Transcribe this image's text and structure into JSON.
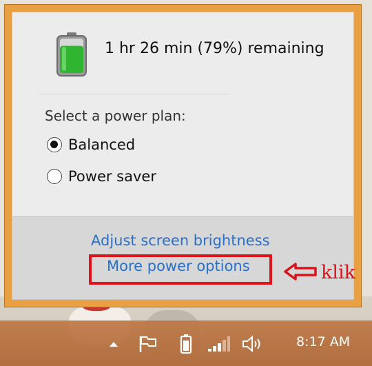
{
  "battery": {
    "status_text": "1 hr 26 min (79%) remaining",
    "charge_percent": 79,
    "icon": "battery-icon"
  },
  "power_plan": {
    "title": "Select a power plan:",
    "options": [
      {
        "label": "Balanced",
        "selected": true
      },
      {
        "label": "Power saver",
        "selected": false
      }
    ]
  },
  "links": {
    "brightness": "Adjust screen brightness",
    "more_options": "More power options"
  },
  "annotation": {
    "label": "klik",
    "color": "#d8141b"
  },
  "taskbar": {
    "icons": [
      "show-hidden-icons-icon",
      "action-center-flag-icon",
      "battery-tray-icon",
      "network-signal-icon",
      "volume-icon"
    ],
    "clock": "8:17 AM"
  },
  "colors": {
    "flyout_border": "#e8a043",
    "link": "#2a6fc9",
    "battery_fill": "#2fb52f",
    "taskbar": "#b46a3a"
  }
}
